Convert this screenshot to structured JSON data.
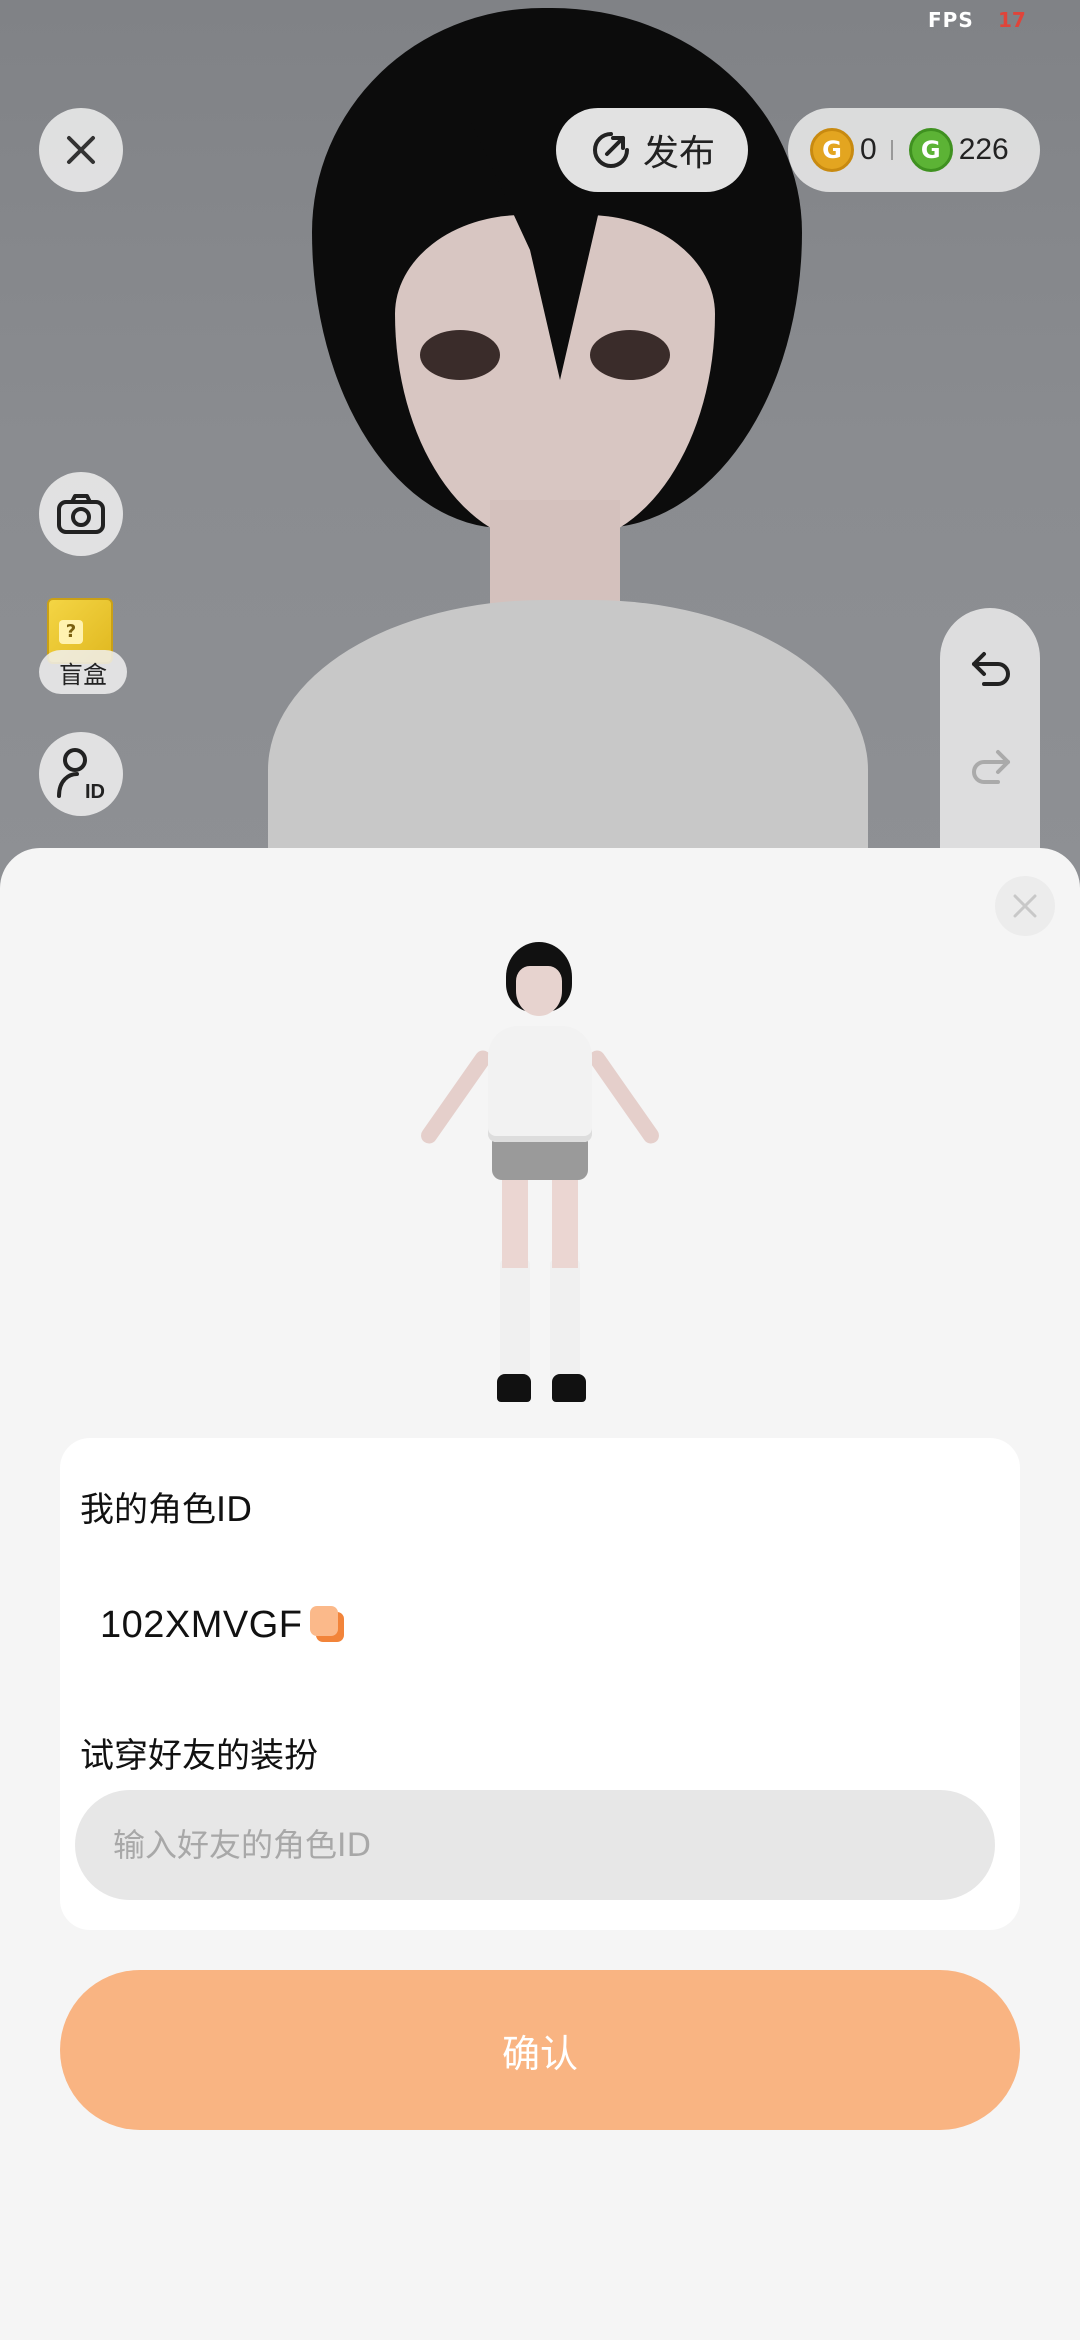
{
  "status": {
    "fps_label": "FPS",
    "fps_value": "17"
  },
  "top_bar": {
    "publish_label": "发布",
    "coins": [
      {
        "icon": "gold-coin-icon",
        "value": "0",
        "color": "#e3a520"
      },
      {
        "icon": "green-coin-icon",
        "value": "226",
        "color": "#5cb335"
      }
    ]
  },
  "side_tools": {
    "blindbox_label": "盲盒"
  },
  "sheet": {
    "my_id_label": "我的角色ID",
    "my_id_value": "102XMVGF",
    "tryon_label": "试穿好友的装扮",
    "friend_input": {
      "placeholder": "输入好友的角色ID",
      "value": ""
    },
    "confirm_label": "确认",
    "accent_color": "#f9b482"
  }
}
